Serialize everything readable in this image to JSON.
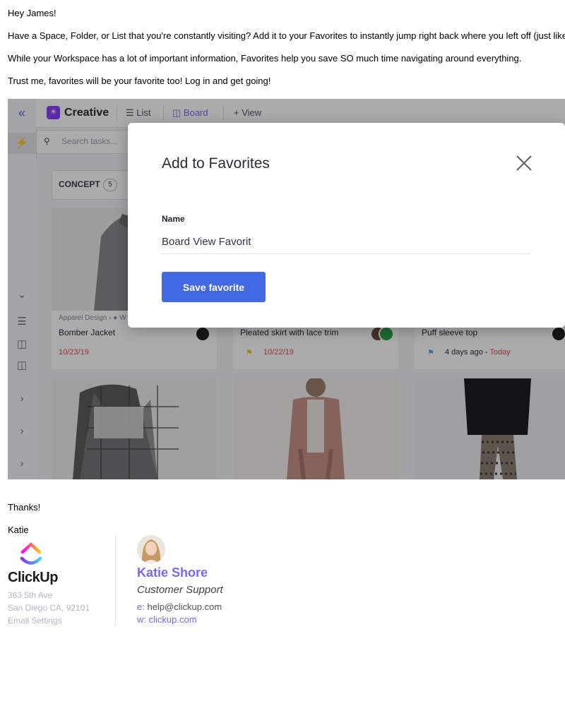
{
  "email": {
    "greeting": "Hey James!",
    "paragraph_1": "Have a Space, Folder, or List that you're constantly visiting? Add it to your Favorites to instantly jump right back where you left off (just like",
    "paragraph_2": "While your Workspace has a lot of important information, Favorites help you save SO much time navigating around everything.",
    "paragraph_3": "Trust me, favorites will be your favorite too! Log in and get going!",
    "thanks": "Thanks!",
    "signoff": "Katie"
  },
  "app": {
    "space_badge": "☀",
    "space_name": "Creative",
    "views": [
      {
        "label": "List",
        "icon": "list-icon"
      },
      {
        "label": "Board",
        "icon": "board-icon"
      },
      {
        "label": "+ View",
        "icon": "plus-icon"
      }
    ],
    "search_placeholder": "Search tasks...",
    "column": {
      "label": "CONCEPT",
      "count": "5"
    },
    "cards": [
      {
        "breadcrumb": "Apparel Design › ● W",
        "title": "Bomber Jacket",
        "meta": "10/23/19",
        "meta_color": "#e5484d"
      },
      {
        "title": "Pleated skirt with lace trim",
        "meta": "10/22/19",
        "meta_color": "#e5484d",
        "flag_color": "#f5c400"
      },
      {
        "title": "Puff sleeve top",
        "meta": "4 days ago",
        "meta_extra": "Today",
        "meta_color": "#1f2430",
        "meta_extra_color": "#e5484d",
        "flag_color": "#5aa0e8"
      }
    ]
  },
  "modal": {
    "title": "Add to Favorites",
    "name_label": "Name",
    "name_value": "Board View Favorit",
    "save_label": "Save favorite"
  },
  "signature": {
    "brand": "ClickUp",
    "address_1": "363 5th Ave",
    "address_2": "San Diego CA, 92101",
    "email_settings": "Email Settings",
    "name": "Katie Shore",
    "role": "Customer Support",
    "email_prefix": "e:",
    "email": "help@clickup.com",
    "web_prefix": "w:",
    "web": "clickup.com",
    "accent_color": "#7b68ee"
  }
}
